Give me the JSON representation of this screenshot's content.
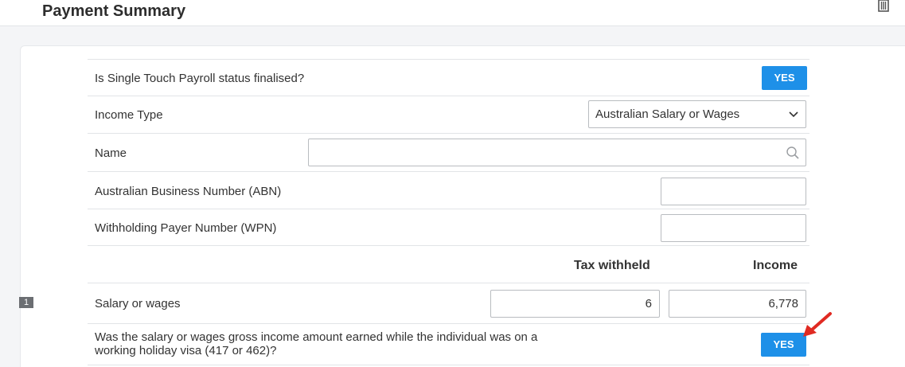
{
  "header": {
    "title": "Payment Summary"
  },
  "rows": {
    "stp_status": {
      "label": "Is Single Touch Payroll status finalised?",
      "button": "YES"
    },
    "income_type": {
      "label": "Income Type",
      "selected": "Australian Salary or Wages"
    },
    "name": {
      "label": "Name",
      "value": ""
    },
    "abn": {
      "label": "Australian Business Number (ABN)",
      "value": ""
    },
    "wpn": {
      "label": "Withholding Payer Number (WPN)",
      "value": ""
    }
  },
  "columns": {
    "tax_withheld": "Tax withheld",
    "income": "Income"
  },
  "salary": {
    "row_number": "1",
    "label": "Salary or wages",
    "tax_withheld": "6",
    "income": "6,778"
  },
  "holiday_visa": {
    "label_line1": "Was the salary or wages gross income amount earned while the individual was on a",
    "label_line2": "working holiday visa (417 or 462)?",
    "button": "YES"
  },
  "colors": {
    "accent": "#1e90e8",
    "annotation_arrow": "#e02a22"
  }
}
